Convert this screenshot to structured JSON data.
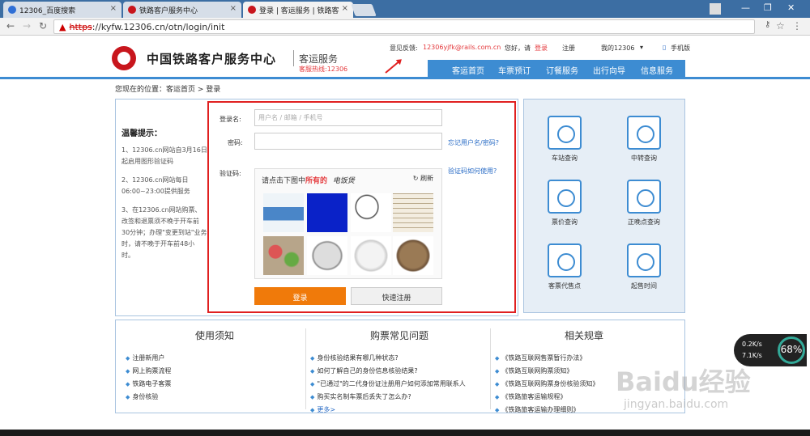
{
  "browser": {
    "tabs": [
      {
        "title": "12306_百度搜索"
      },
      {
        "title": "铁路客户服务中心"
      },
      {
        "title": "登录 | 客运服务 | 铁路客"
      }
    ],
    "url_scheme": "https",
    "url_rest": "://kyfw.12306.cn/otn/login/init"
  },
  "header": {
    "site_title": "中国铁路客户服务中心",
    "site_sub": "客运服务",
    "hotline": "客服热线:12306",
    "feedback_label": "意见反馈:",
    "feedback_email": "12306yjfk@rails.com.cn",
    "greeting": "您好，请",
    "login_link": "登录",
    "register_link": "注册",
    "my12306": "我的12306",
    "mobile": "手机版"
  },
  "mainnav": [
    "客运首页",
    "车票预订",
    "订餐服务",
    "出行向导",
    "信息服务"
  ],
  "breadcrumb": "您现在的位置：客运首页 > 登录",
  "tips": {
    "title": "温馨提示：",
    "items": [
      "1、12306.cn网站自3月16日起启用图形验证码",
      "2、12306.cn网站每日06:00~23:00提供服务",
      "3、在12306.cn网站购票、改签和退票须不晚于开车前30分钟；办理\"变更到站\"业务时，请不晚于开车前48小时。"
    ]
  },
  "login": {
    "username_label": "登录名:",
    "username_placeholder": "用户名 / 邮箱 / 手机号",
    "password_label": "密码:",
    "forgot_link": "忘记用户名/密码?",
    "captcha_label": "验证码:",
    "captcha_help": "验证码如何使用?",
    "captcha_prompt_pre": "请点击下图中",
    "captcha_prompt_bold": "所有的",
    "captcha_target": "电饭煲",
    "captcha_refresh": "刷新",
    "login_button": "登录",
    "register_button": "快速注册"
  },
  "services": [
    {
      "label": "车站查询"
    },
    {
      "label": "中转查询"
    },
    {
      "label": "票价查询"
    },
    {
      "label": "正晚点查询"
    },
    {
      "label": "客票代售点"
    },
    {
      "label": "起售时间"
    }
  ],
  "info": {
    "col1": {
      "title": "使用须知",
      "items": [
        "注册新用户",
        "网上购票流程",
        "铁路电子客票",
        "身份核验"
      ]
    },
    "col2": {
      "title": "购票常见问题",
      "items": [
        "身份核验结果有哪几种状态?",
        "如何了解自己的身份信息核验结果?",
        "\"已通过\"的二代身份证注册用户如何添加常用联系人",
        "购买实名制车票后丢失了怎么办?"
      ],
      "more": "更多>"
    },
    "col3": {
      "title": "相关规章",
      "items": [
        "《铁路互联网售票暂行办法》",
        "《铁路互联网购票须知》",
        "《铁路互联网购票身份核验须知》",
        "《铁路旅客运输规程》",
        "《铁路旅客运输办理细则》"
      ]
    }
  },
  "overlay": {
    "up": "0.2K/s",
    "down": "7.1K/s",
    "pct": "68%"
  },
  "watermark": {
    "brand": "Baidu经验",
    "url": "jingyan.baidu.com"
  }
}
